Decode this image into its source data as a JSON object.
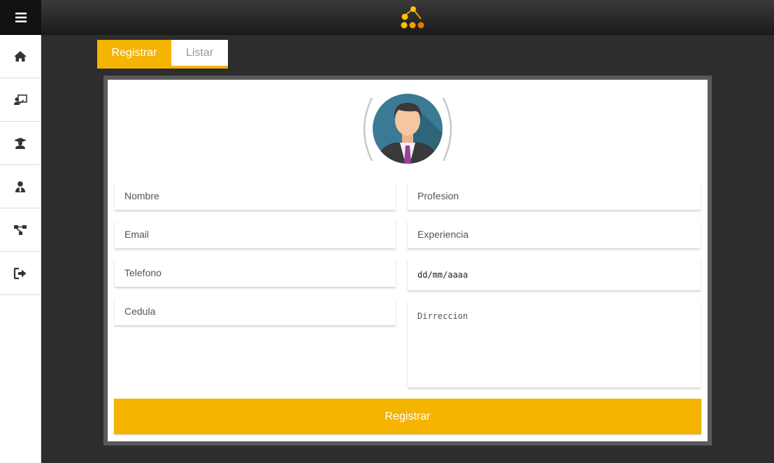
{
  "topbar": {
    "menu_icon": "hamburger-icon",
    "logo_icon": "network-dots-logo"
  },
  "sidebar": {
    "items": [
      {
        "icon": "home-icon"
      },
      {
        "icon": "teacher-board-icon"
      },
      {
        "icon": "graduate-icon"
      },
      {
        "icon": "user-tie-icon"
      },
      {
        "icon": "sitemap-icon"
      },
      {
        "icon": "sign-out-icon"
      }
    ]
  },
  "tabs": [
    {
      "label": "Registrar",
      "active": true
    },
    {
      "label": "Listar",
      "active": false
    }
  ],
  "form": {
    "left": {
      "nombre_placeholder": "Nombre",
      "email_placeholder": "Email",
      "telefono_placeholder": "Telefono",
      "cedula_placeholder": "Cedula"
    },
    "right": {
      "profesion_placeholder": "Profesion",
      "experiencia_placeholder": "Experiencia",
      "date_placeholder": "dd/mm/aaaa",
      "direccion_placeholder": "Dirreccion"
    },
    "submit_label": "Registrar"
  },
  "colors": {
    "accent": "#f5b400",
    "background": "#2d2d2d",
    "topbar": "#1a1a1a"
  }
}
